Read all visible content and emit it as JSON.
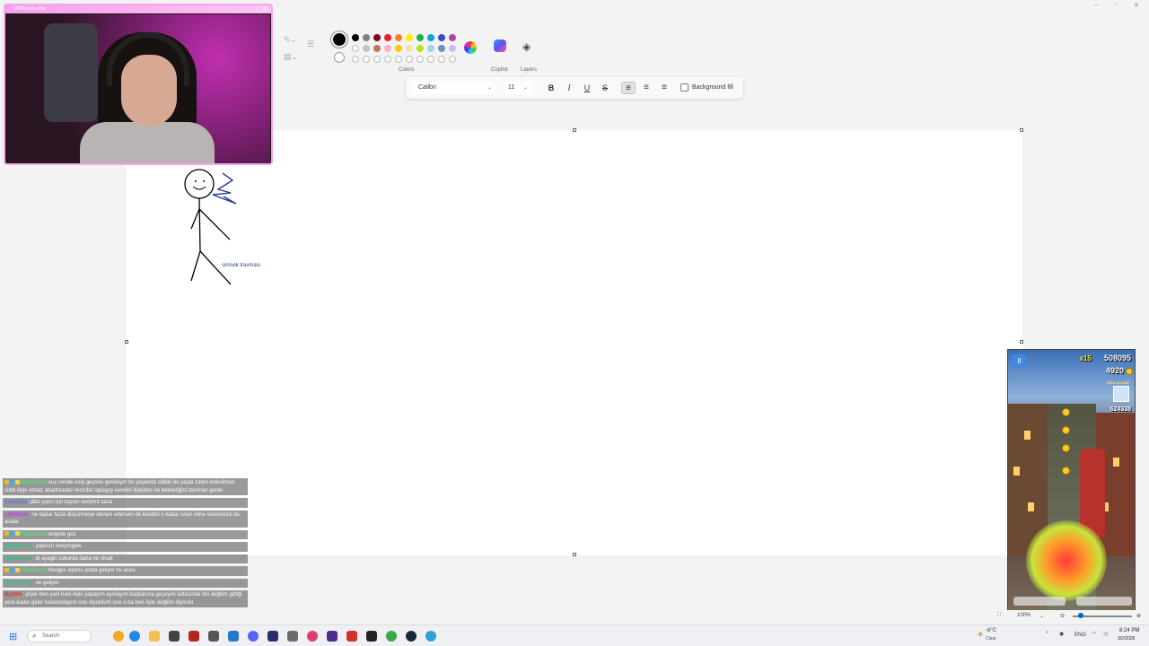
{
  "window": {
    "minimize": "–",
    "maximize": "▫",
    "close": "✕"
  },
  "ribbon": {
    "colors_label": "Colors",
    "copilot_label": "Copilot",
    "layers_label": "Layers",
    "primary_color": "#000000",
    "secondary_color": "#ffffff",
    "palette_row1": [
      "#000000",
      "#7f7f7f",
      "#880015",
      "#ed1c24",
      "#ff7f27",
      "#fff200",
      "#22b14c",
      "#00a2e8",
      "#3f48cc",
      "#a349a4"
    ],
    "palette_row2": [
      "#ffffff",
      "#c3c3c3",
      "#b97a57",
      "#ffaec9",
      "#ffc90e",
      "#efe4b0",
      "#b5e61d",
      "#99d9ea",
      "#7092be",
      "#c8bfe7"
    ],
    "palette_row3_count": 10
  },
  "textbar": {
    "font": "Calibri",
    "size": "11",
    "bold": "B",
    "italic": "I",
    "underline": "U",
    "strikethrough": "S",
    "align_left": "≡",
    "align_center": "≡",
    "align_right": "≡",
    "background_fill": "Background fill"
  },
  "canvas": {
    "drawing_caption": "simsek travması"
  },
  "webcam": {
    "title": "Webcam.exe",
    "close": "✕"
  },
  "chat": [
    {
      "user": "PikoGami",
      "user_color": "#5de07a",
      "text": "suç sende esip geçmei gerekiyor bu yaşlarda cidbki bu yaşta zaten evlenilmez ciddi ilişki olmaz abartmadan tecrübe toplayıp kendini ilişkiden ne beklediğini tanıman gerek"
    },
    {
      "user": "ssmsslis",
      "user_color": "#4a7dd6",
      "text": "piko yarın için kupon veriyimi sana"
    },
    {
      "user": "uhtedilon",
      "user_color": "#b44cd6",
      "text": "ne kadar fazla düşünmeye devam edersen de kendini o kadar onun eline vereceksin bu arada"
    },
    {
      "user": "PikoGami",
      "user_color": "#5de07a",
      "text": "engelle geç"
    },
    {
      "user": "dfaldsadas",
      "user_color": "#3fbf86",
      "text": "yaşlısın seopmgew"
    },
    {
      "user": "dfaldsadas",
      "user_color": "#3fbf86",
      "text": "bi ayagin cukurda daha ne olcak"
    },
    {
      "user": "PikoGami",
      "user_color": "#5de07a",
      "text": "Nerges siperis yolda geliyor bu arası"
    },
    {
      "user": "dfaldsadas",
      "user_color": "#3fbf86",
      "text": "ne geliyor"
    },
    {
      "user": "Byzbni",
      "user_color": "#d43a3a",
      "text": "şöyle ben yani hani ilişki yapayım ayrılayım başkasına geçeyim kafasında biri değilim gittiği yere kadar gider kafasındayım onu diyordum one o da ben öyle değilim diyordu"
    }
  ],
  "game": {
    "pause": "II",
    "multiplier": "x15",
    "score": "508095",
    "coins": "4920",
    "high_score_label": "HIGH SCORE",
    "high_score": "624338"
  },
  "statusbar": {
    "zoom": "100%"
  },
  "taskbar": {
    "search_placeholder": "Search",
    "weather_temp": "-6°C",
    "weather_condition": "Clear",
    "language": "ENG",
    "time": "8:24 PM",
    "date": "3/2/2026"
  }
}
